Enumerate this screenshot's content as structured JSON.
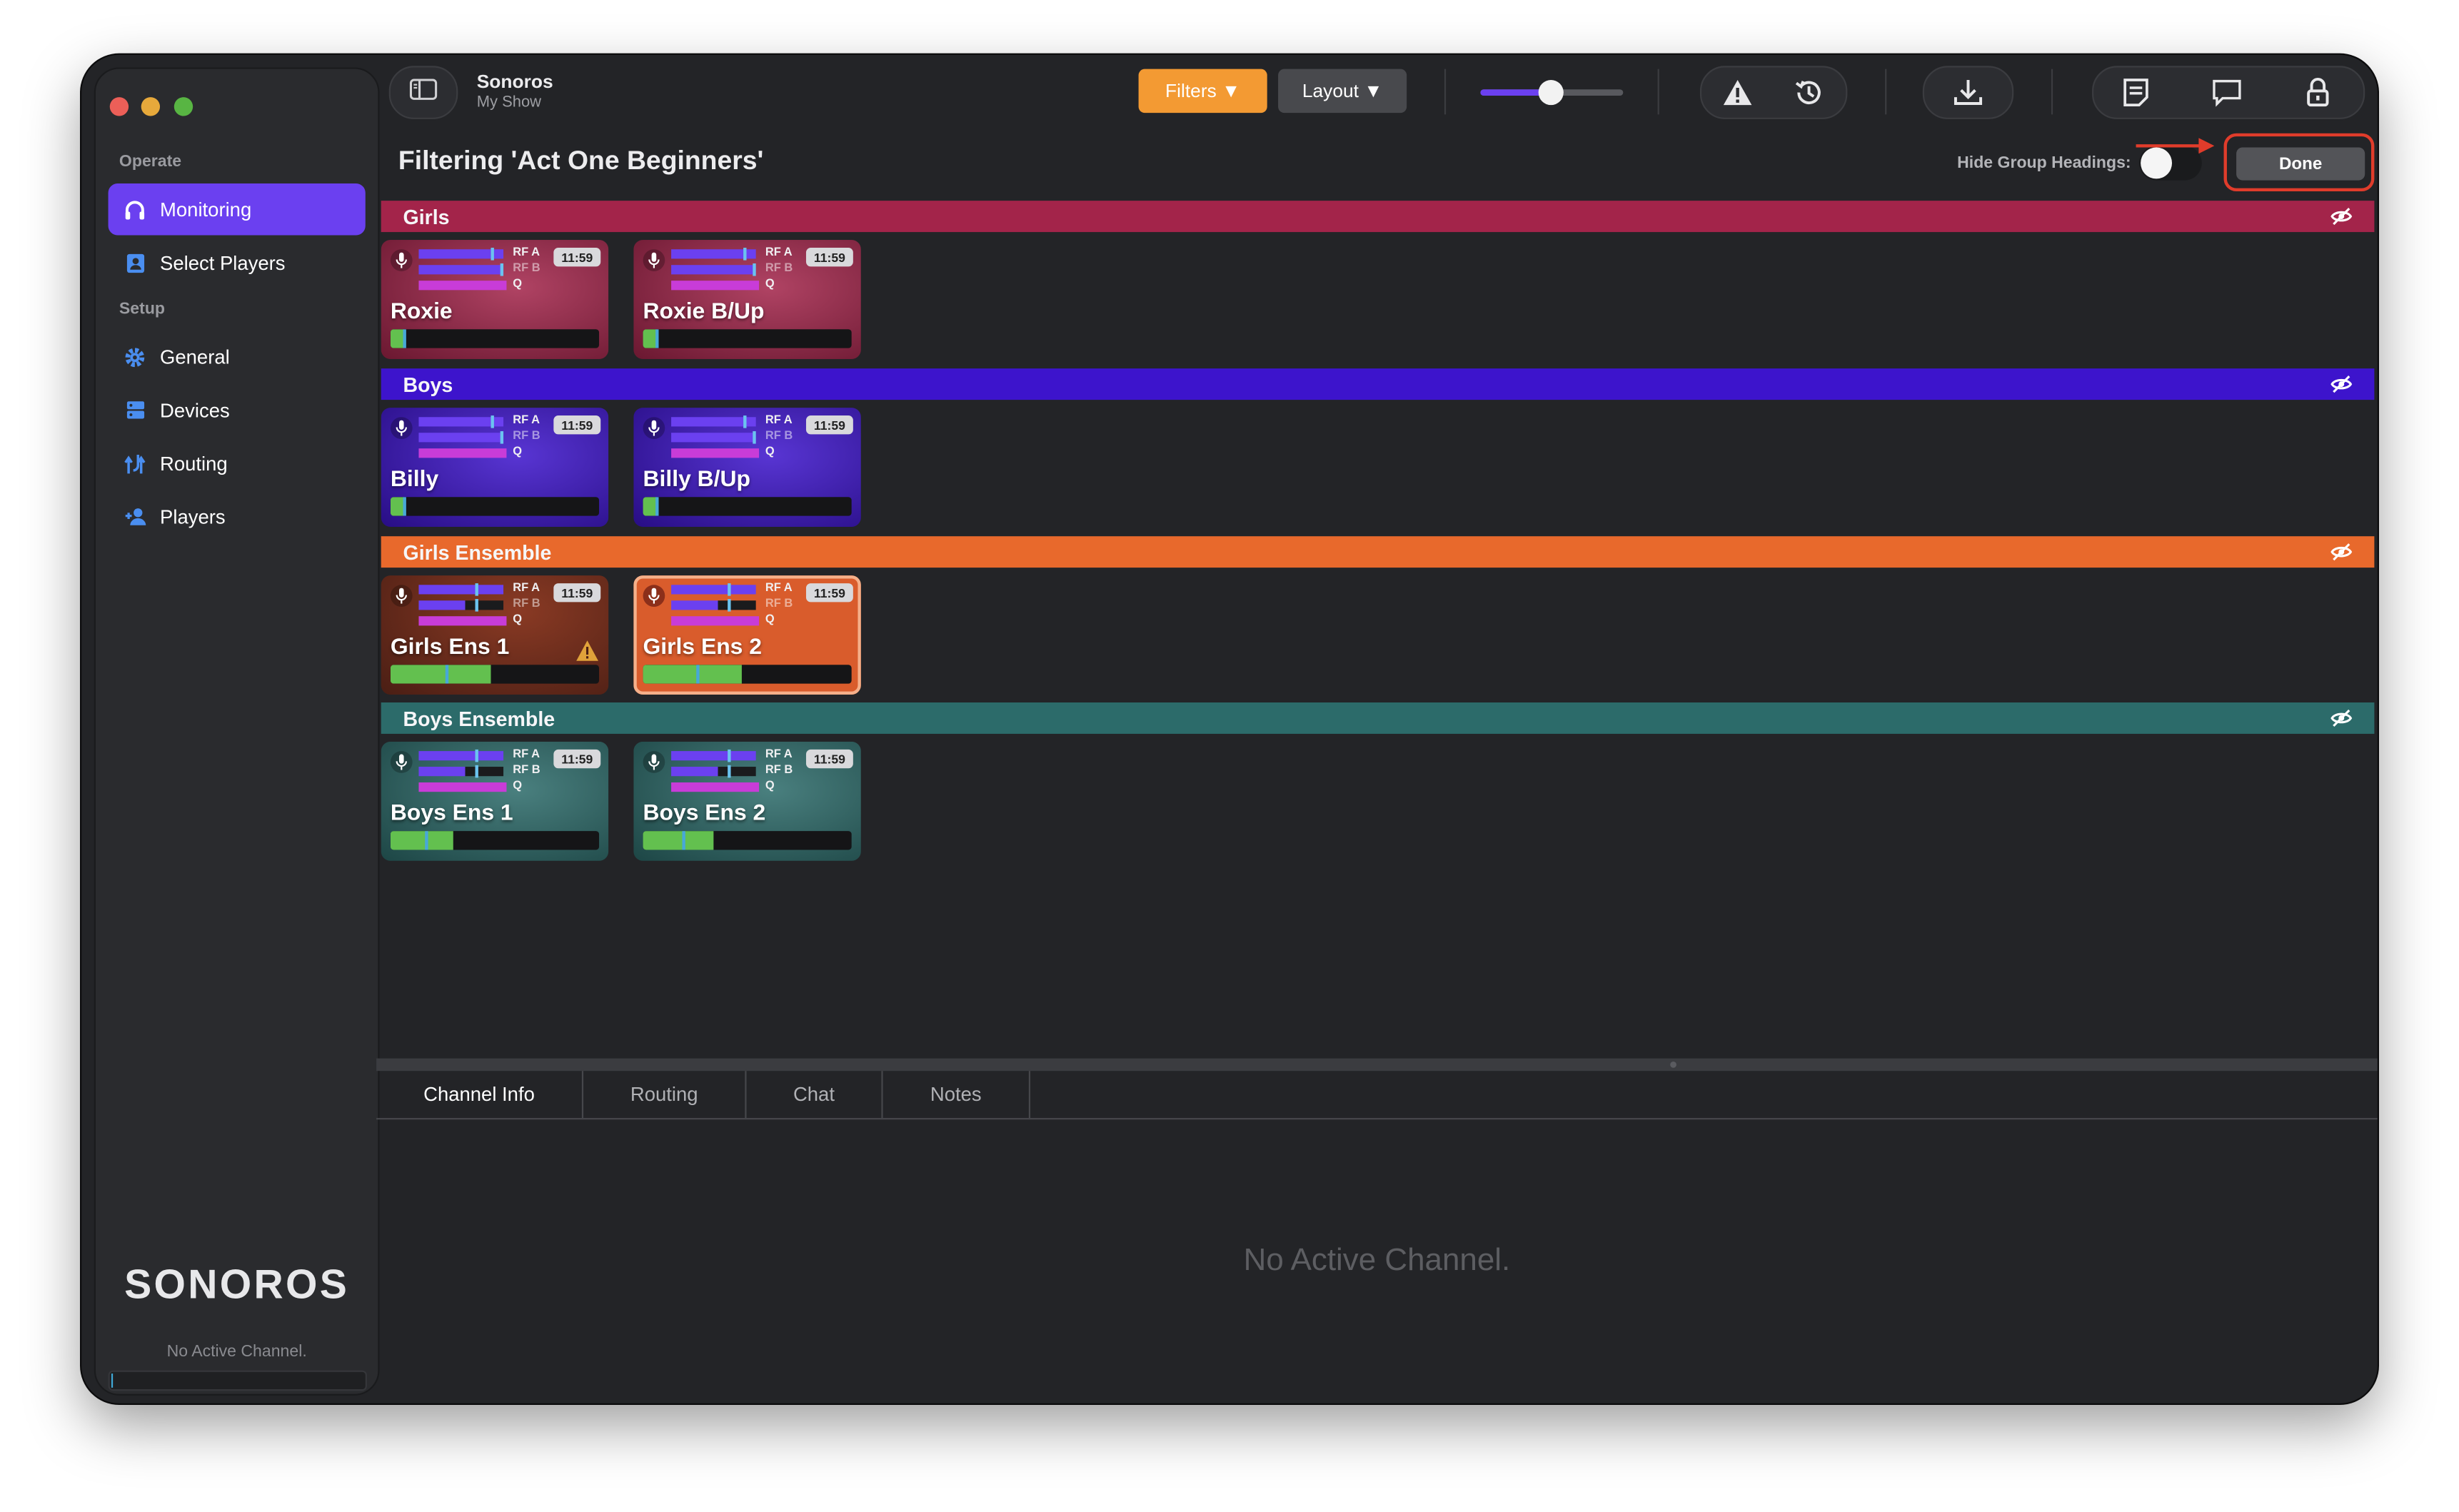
{
  "app": {
    "title": "Sonoros",
    "subtitle": "My Show",
    "brand": "SONOROS"
  },
  "sidebar": {
    "sections": [
      {
        "heading": "Operate",
        "items": [
          {
            "label": "Monitoring",
            "icon": "headphones-icon",
            "active": true
          },
          {
            "label": "Select Players",
            "icon": "contact-card-icon",
            "active": false
          }
        ]
      },
      {
        "heading": "Setup",
        "items": [
          {
            "label": "General",
            "icon": "gear-icon",
            "active": false
          },
          {
            "label": "Devices",
            "icon": "server-icon",
            "active": false
          },
          {
            "label": "Routing",
            "icon": "routing-icon",
            "active": false
          },
          {
            "label": "Players",
            "icon": "add-person-icon",
            "active": false
          }
        ]
      }
    ],
    "status": "No Active Channel."
  },
  "toolbar": {
    "filters_label": "Filters ▼",
    "layout_label": "Layout ▼",
    "volume": 0.49
  },
  "header": {
    "filter_title": "Filtering 'Act One Beginners'",
    "hide_group_headings_label": "Hide Group Headings:",
    "hide_group_headings_on": false,
    "done_label": "Done"
  },
  "groups": [
    {
      "name": "Girls",
      "color": "#a3244a",
      "cards": [
        {
          "name": "Roxie",
          "clock": "11:59",
          "rf_a": "RF A",
          "rf_b": "RF B",
          "q": "Q",
          "level": 0.07
        },
        {
          "name": "Roxie B/Up",
          "clock": "11:59",
          "rf_a": "RF A",
          "rf_b": "RF B",
          "q": "Q",
          "level": 0.07
        }
      ]
    },
    {
      "name": "Boys",
      "color": "#3d14cc",
      "cards": [
        {
          "name": "Billy",
          "clock": "11:59",
          "rf_a": "RF A",
          "rf_b": "RF B",
          "q": "Q",
          "level": 0.07
        },
        {
          "name": "Billy B/Up",
          "clock": "11:59",
          "rf_a": "RF A",
          "rf_b": "RF B",
          "q": "Q",
          "level": 0.07
        }
      ]
    },
    {
      "name": "Girls Ensemble",
      "color": "#e8692c",
      "cards": [
        {
          "name": "Girls Ens 1",
          "clock": "11:59",
          "rf_a": "RF A",
          "rf_b": "RF B",
          "q": "Q",
          "level": 0.48,
          "warning": true
        },
        {
          "name": "Girls Ens 2",
          "clock": "11:59",
          "rf_a": "RF A",
          "rf_b": "RF B",
          "q": "Q",
          "level": 0.47
        }
      ]
    },
    {
      "name": "Boys Ensemble",
      "color": "#2c6b6a",
      "cards": [
        {
          "name": "Boys Ens 1",
          "clock": "11:59",
          "rf_a": "RF A",
          "rf_b": "RF B",
          "q": "Q",
          "level": 0.3
        },
        {
          "name": "Boys Ens 2",
          "clock": "11:59",
          "rf_a": "RF A",
          "rf_b": "RF B",
          "q": "Q",
          "level": 0.34
        }
      ]
    }
  ],
  "bottom_tabs": [
    "Channel Info",
    "Routing",
    "Chat",
    "Notes"
  ],
  "active_tab": "Channel Info",
  "empty_message": "No Active Channel.",
  "colors": {
    "accent": "#6b40f0",
    "filters": "#f39a33",
    "meter": "#63c04f",
    "done_highlight": "#e03c2b"
  }
}
